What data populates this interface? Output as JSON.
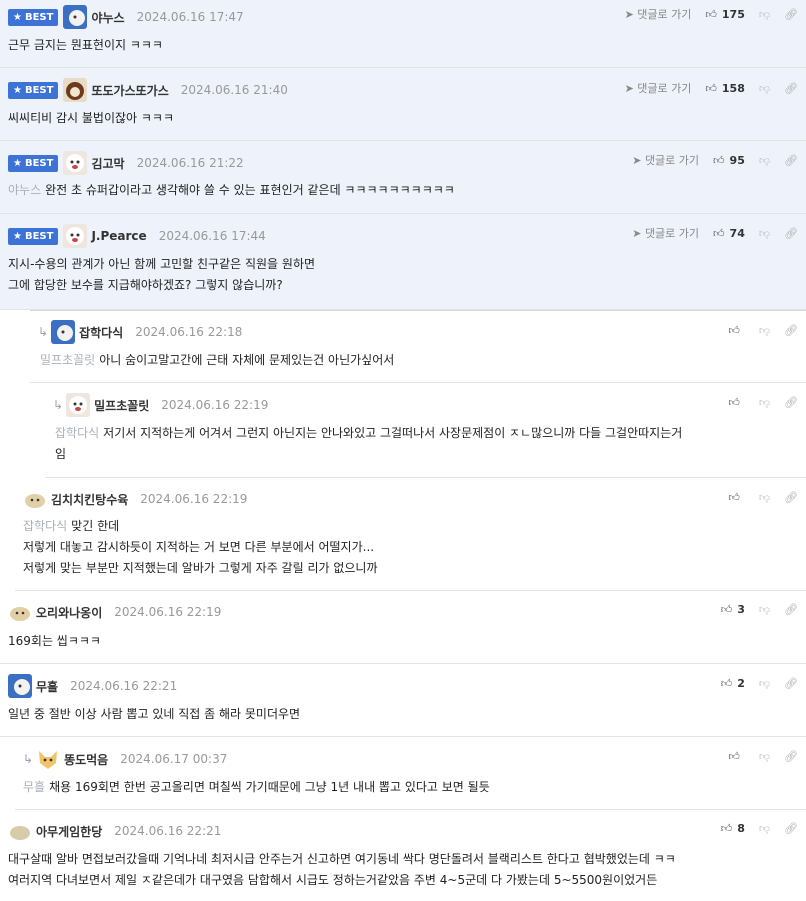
{
  "ui": {
    "best_label": "BEST",
    "reply_link_label": "댓글로 가기"
  },
  "comments": [
    {
      "nick": "야누스",
      "date": "2024.06.16 17:47",
      "likes": "175",
      "mention": "",
      "lines": [
        "근무 금지는 뭔표현이지 ㅋㅋㅋ"
      ]
    },
    {
      "nick": "또도가스또가스",
      "date": "2024.06.16 21:40",
      "likes": "158",
      "mention": "",
      "lines": [
        "씨씨티비 감시 불법이잖아 ㅋㅋㅋ"
      ]
    },
    {
      "nick": "김고막",
      "date": "2024.06.16 21:22",
      "likes": "95",
      "mention": "야누스",
      "lines": [
        "완전 초 슈퍼갑이라고 생각해야 쓸 수 있는 표현인거 같은데 ㅋㅋㅋㅋㅋㅋㅋㅋㅋㅋ"
      ]
    },
    {
      "nick": "J.Pearce",
      "date": "2024.06.16 17:44",
      "likes": "74",
      "mention": "",
      "lines": [
        "지시-수용의 관계가 아닌 함께 고민할 친구같은 직원을 원하면",
        "그에 합당한 보수를 지급해야하겠죠? 그렇지 않습니까?"
      ]
    },
    {
      "nick": "잡학다식",
      "date": "2024.06.16 22:18",
      "likes": "",
      "mention": "밀프초꼴릿",
      "lines": [
        "아니 숨이고말고간에 근태 자체에 문제있는건 아닌가싶어서"
      ]
    },
    {
      "nick": "밀프초꼴릿",
      "date": "2024.06.16 22:19",
      "likes": "",
      "mention": "잡학다식",
      "lines": [
        "저기서 지적하는게 어겨서 그런지 아닌지는 안나와있고 그걸떠나서 사장문제점이 ㅈㄴ많으니까 다들 그걸안따지는거",
        "임"
      ]
    },
    {
      "nick": "김치치킨탕수육",
      "date": "2024.06.16 22:19",
      "likes": "",
      "mention": "잡학다식",
      "lines": [
        "맞긴 한데",
        "저렇게 대놓고 감시하듯이 지적하는 거 보면 다른 부분에서 어떨지가...",
        "저렇게 맞는 부분만 지적했는데 알바가 그렇게 자주 갈릴 리가 없으니까"
      ]
    },
    {
      "nick": "오리와나옹이",
      "date": "2024.06.16 22:19",
      "likes": "3",
      "mention": "",
      "lines": [
        "169회는 씹ㅋㅋㅋ"
      ]
    },
    {
      "nick": "무흘",
      "date": "2024.06.16 22:21",
      "likes": "2",
      "mention": "",
      "lines": [
        "일년 중 절반 이상 사람 뽑고 있네 직접 좀 해라 못미더우면"
      ]
    },
    {
      "nick": "똥도먹음",
      "date": "2024.06.17 00:37",
      "likes": "",
      "mention": "무흘",
      "lines": [
        "채용 169회면 한번 공고올리면 며칠씩 가기때문에 그냥 1년 내내 뽑고 있다고 보면 될듯"
      ]
    },
    {
      "nick": "아무게임한당",
      "date": "2024.06.16 22:21",
      "likes": "8",
      "mention": "",
      "lines": [
        "대구살때 알바 면접보러갔을때 기억나네 최저시급 안주는거 신고하면 여기동네 싹다 명단돌려서 블랙리스트 한다고 협박했었는데 ㅋㅋ",
        "여러지역 다녀보면서 제일 ㅈ같은데가 대구였음 담합해서 시급도 정하는거같았음 주변 4~5군데 다 가봤는데 5~5500원이었거든"
      ]
    }
  ]
}
